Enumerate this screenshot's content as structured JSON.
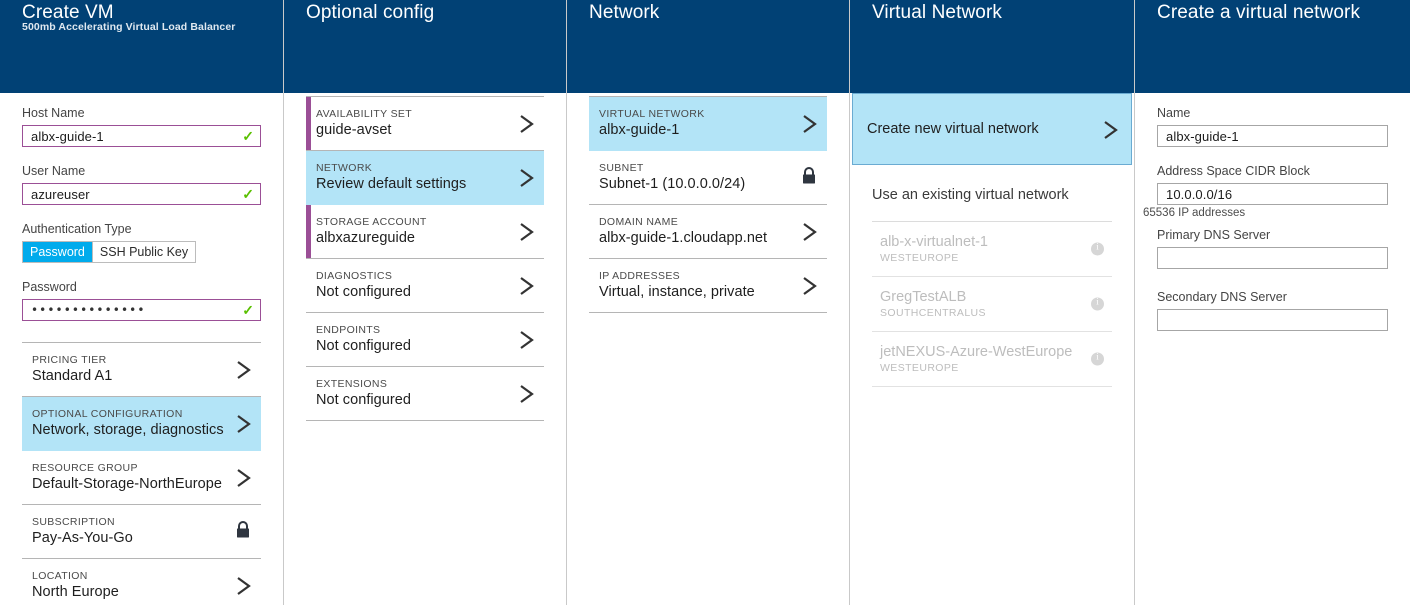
{
  "blades": {
    "create_vm": {
      "title": "Create VM",
      "subtitle": "500mb Accelerating Virtual Load Balancer",
      "fields": {
        "host_name_label": "Host Name",
        "host_name_value": "albx-guide-1",
        "user_name_label": "User Name",
        "user_name_value": "azureuser",
        "auth_type_label": "Authentication Type",
        "auth_password": "Password",
        "auth_ssh": "SSH Public Key",
        "password_label": "Password",
        "password_value": "••••••••••••••"
      },
      "rows": [
        {
          "caption": "PRICING TIER",
          "value": "Standard A1",
          "icon": "chevron-right-icon"
        },
        {
          "caption": "OPTIONAL CONFIGURATION",
          "value": "Network, storage, diagnostics",
          "icon": "chevron-right-icon"
        },
        {
          "caption": "RESOURCE GROUP",
          "value": "Default-Storage-NorthEurope",
          "icon": "chevron-right-icon"
        },
        {
          "caption": "SUBSCRIPTION",
          "value": "Pay-As-You-Go",
          "icon": "lock-icon"
        },
        {
          "caption": "LOCATION",
          "value": "North Europe",
          "icon": "chevron-right-icon"
        }
      ]
    },
    "optional_config": {
      "title": "Optional config",
      "rows": [
        {
          "caption": "AVAILABILITY SET",
          "value": "guide-avset",
          "icon": "chevron-right-icon"
        },
        {
          "caption": "NETWORK",
          "value": "Review default settings",
          "icon": "chevron-right-icon"
        },
        {
          "caption": "STORAGE ACCOUNT",
          "value": "albxazureguide",
          "icon": "chevron-right-icon"
        },
        {
          "caption": "DIAGNOSTICS",
          "value": "Not configured",
          "icon": "chevron-right-icon"
        },
        {
          "caption": "ENDPOINTS",
          "value": "Not configured",
          "icon": "chevron-right-icon"
        },
        {
          "caption": "EXTENSIONS",
          "value": "Not configured",
          "icon": "chevron-right-icon"
        }
      ]
    },
    "network": {
      "title": "Network",
      "rows": [
        {
          "caption": "VIRTUAL NETWORK",
          "value": "albx-guide-1",
          "icon": "chevron-right-icon"
        },
        {
          "caption": "SUBNET",
          "value": "Subnet-1 (10.0.0.0/24)",
          "icon": "lock-icon"
        },
        {
          "caption": "DOMAIN NAME",
          "value": "albx-guide-1.cloudapp.net",
          "icon": "chevron-right-icon"
        },
        {
          "caption": "IP ADDRESSES",
          "value": "Virtual, instance, private",
          "icon": "chevron-right-icon"
        }
      ]
    },
    "virtual_network": {
      "title": "Virtual Network",
      "create_new_label": "Create new virtual network",
      "existing_header": "Use an existing virtual network",
      "existing": [
        {
          "name": "alb-x-virtualnet-1",
          "region": "WESTEUROPE"
        },
        {
          "name": "GregTestALB",
          "region": "SOUTHCENTRALUS"
        },
        {
          "name": "jetNEXUS-Azure-WestEurope",
          "region": "WESTEUROPE"
        }
      ]
    },
    "create_vnet": {
      "title": "Create a virtual network",
      "name_label": "Name",
      "name_value": "albx-guide-1",
      "cidr_label": "Address Space CIDR Block",
      "cidr_value": "10.0.0.0/16",
      "cidr_hint": "65536 IP addresses",
      "primary_dns_label": "Primary DNS Server",
      "primary_dns_value": "",
      "secondary_dns_label": "Secondary DNS Server",
      "secondary_dns_value": ""
    }
  },
  "colors": {
    "header_blue": "#014175",
    "selected_cyan": "#b3e4f7",
    "accent_purple": "#9b4f96",
    "valid_green": "#5ac000",
    "toggle_blue": "#00abec"
  }
}
